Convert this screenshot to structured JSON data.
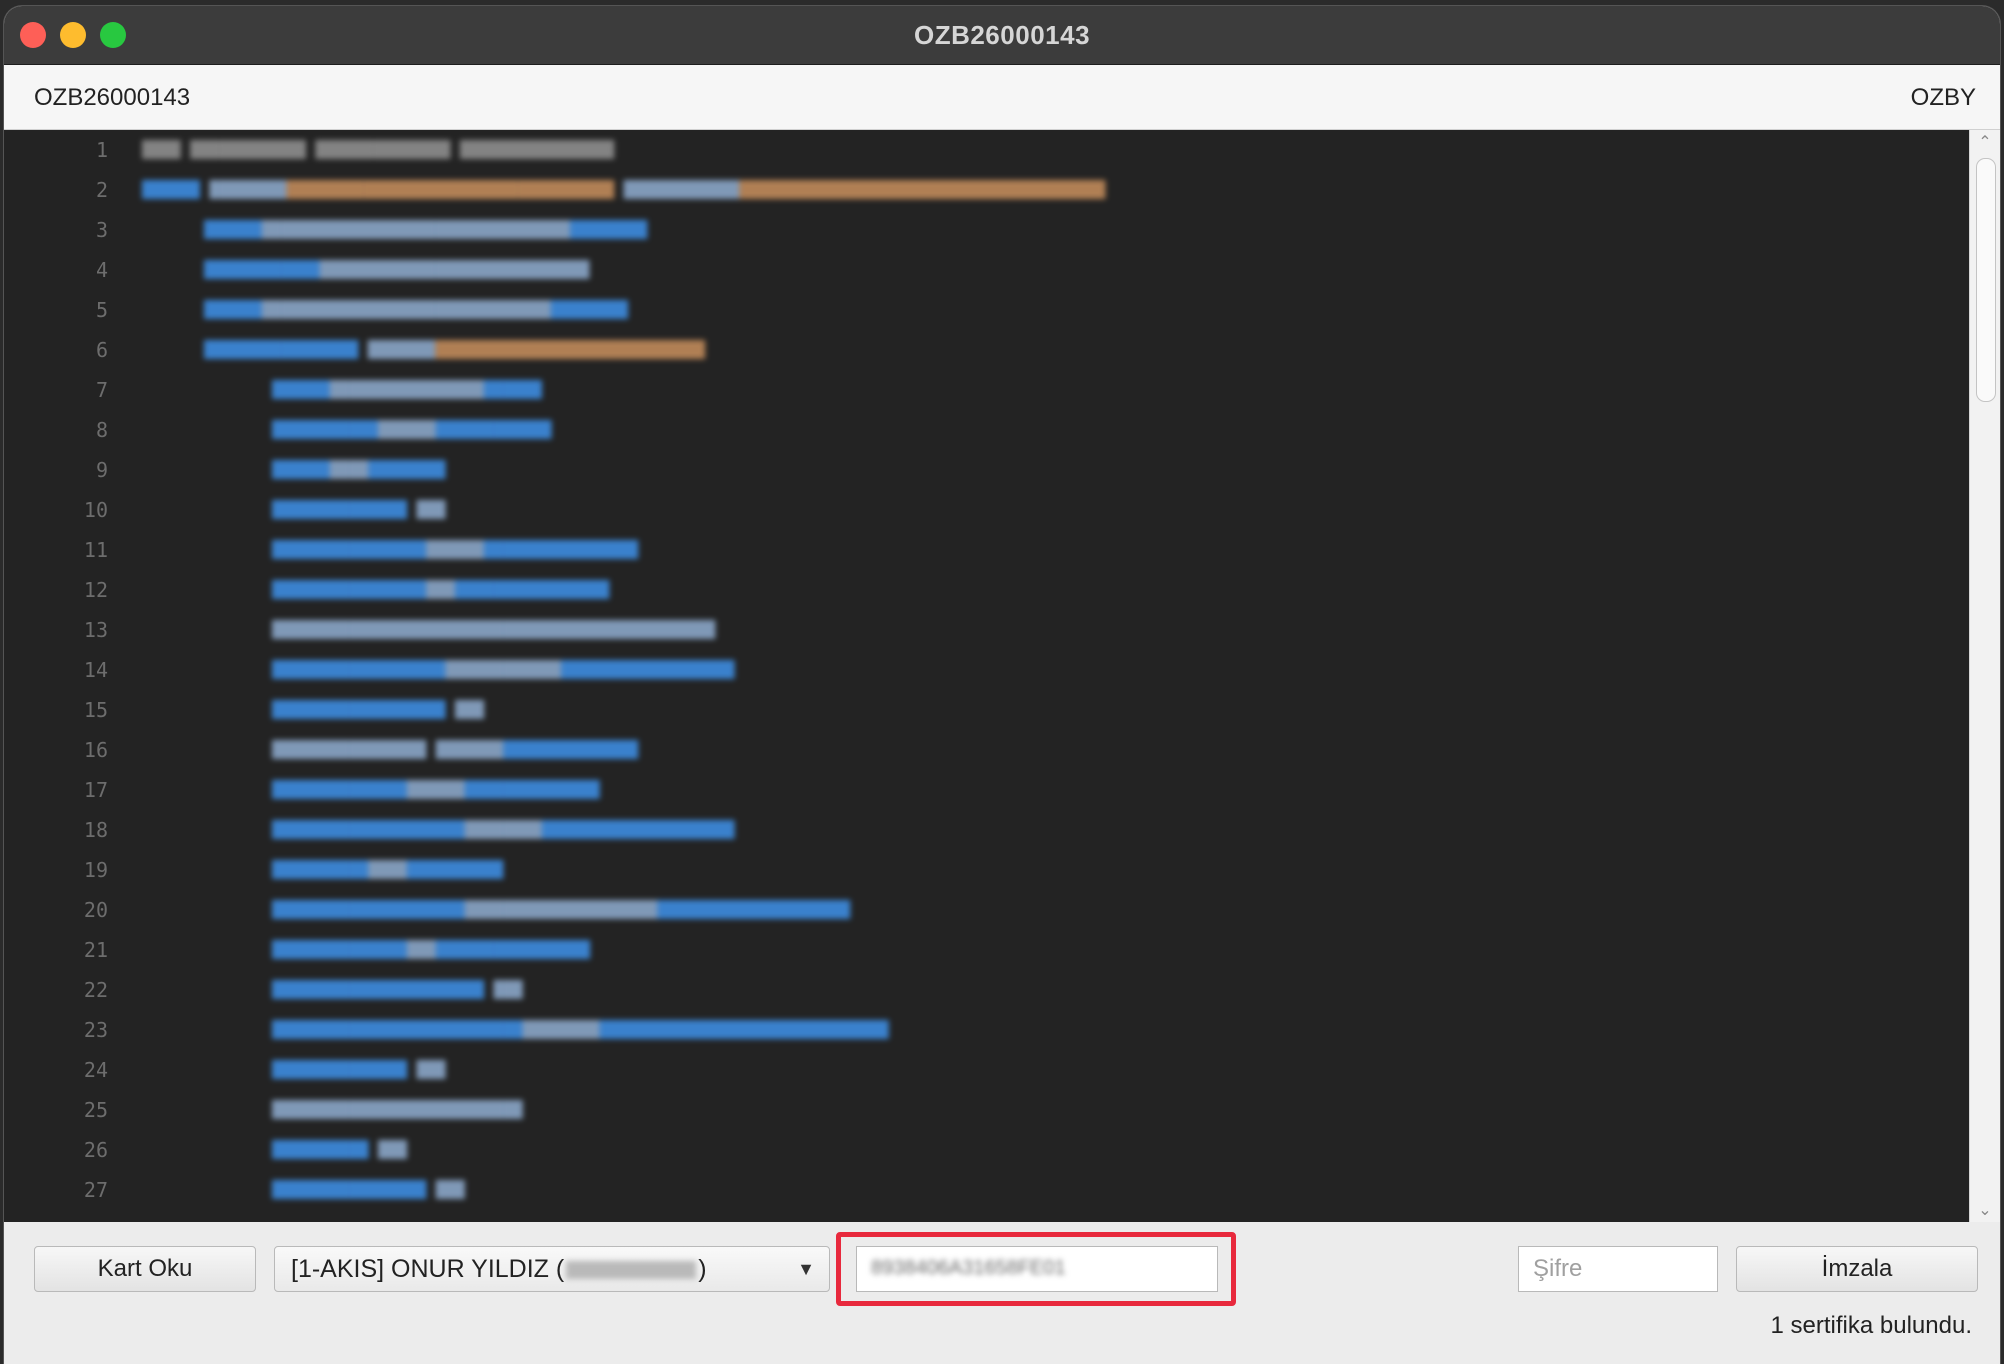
{
  "window": {
    "title": "OZB26000143"
  },
  "infobar": {
    "left_text": "OZB26000143",
    "right_text": "OZBY"
  },
  "editor": {
    "line_numbers": [
      "1",
      "2",
      "3",
      "4",
      "5",
      "6",
      "7",
      "8",
      "9",
      "10",
      "11",
      "12",
      "13",
      "14",
      "15",
      "16",
      "17",
      "18",
      "19",
      "20",
      "21",
      "22",
      "23",
      "24",
      "25",
      "26",
      "27"
    ]
  },
  "bottom": {
    "read_card_label": "Kart Oku",
    "certificate_prefix": "[1-AKIS] ONUR YILDIZ (",
    "certificate_suffix": ")",
    "serial_value": "8938406A31658FE01",
    "password_placeholder": "Şifre",
    "sign_label": "İmzala",
    "status_text": "1 sertifika bulundu."
  },
  "colors": {
    "highlight": "#e8293d",
    "editor_bg": "#232323",
    "tag_blue": "#3d8ce0"
  },
  "icons": {
    "dropdown": "chevron-down-icon",
    "scroll_up": "scroll-up-arrow-icon",
    "scroll_down": "scroll-down-arrow-icon"
  }
}
